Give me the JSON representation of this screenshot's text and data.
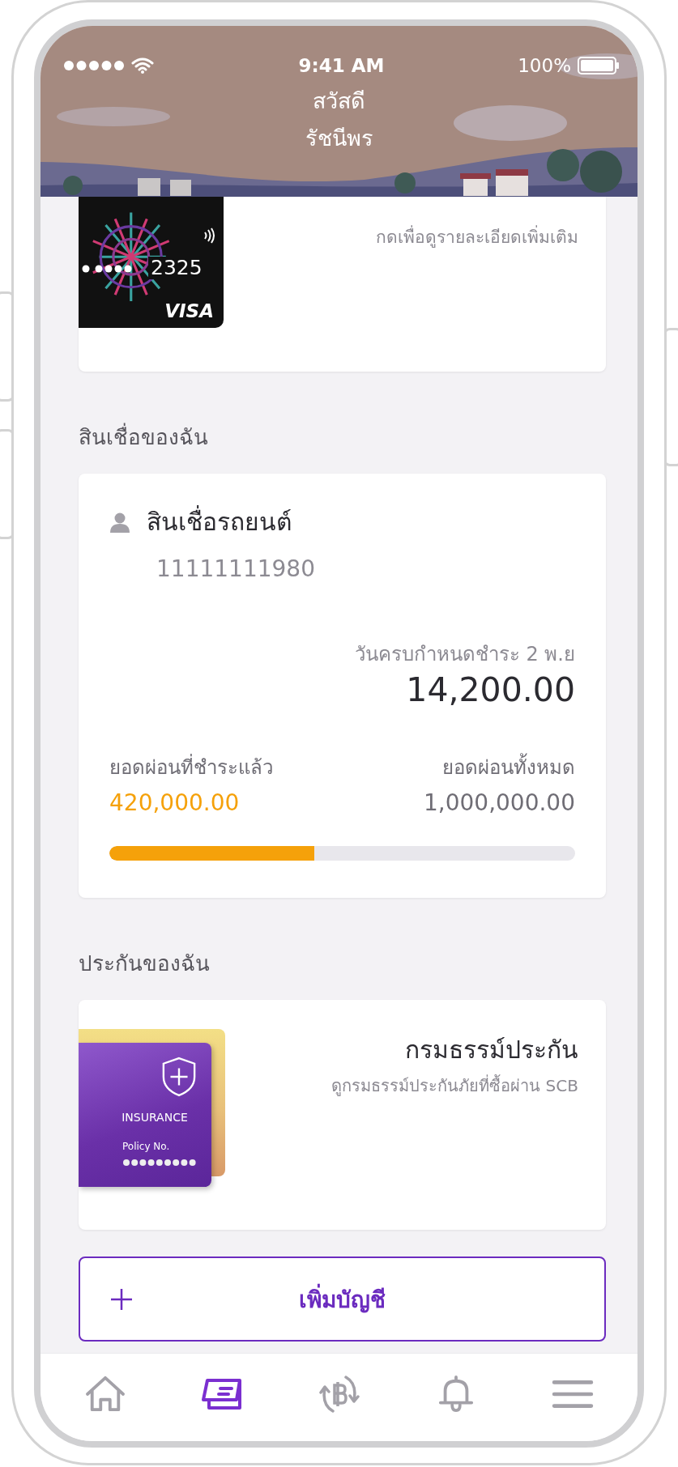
{
  "status_bar": {
    "time": "9:41 AM",
    "battery": "100%"
  },
  "header": {
    "greeting": "สวัสดี",
    "name": "รัชนีพร"
  },
  "card_account": {
    "last_digits": "2325",
    "network": "VISA",
    "hint": "กดเพื่อดูรายละเอียดเพิ่มเติม"
  },
  "loans": {
    "title": "สินเชื่อของฉัน",
    "name": "สินเชื่อรถยนต์",
    "account_number": "11111111980",
    "due_label": "วันครบกำหนดชำระ 2 พ.ย",
    "due_amount": "14,200.00",
    "paid_label": "ยอดผ่อนที่ชำระแล้ว",
    "paid_amount": "420,000.00",
    "total_label": "ยอดผ่อนทั้งหมด",
    "total_amount": "1,000,000.00",
    "level": 0.44
  },
  "insurance": {
    "title": "ประกันของฉัน",
    "card_label": "INSURANCE",
    "card_policy_label": "Policy No.",
    "name": "กรมธรรม์ประกัน",
    "description": "ดูกรมธรรม์ประกันภัยที่ซื้อผ่าน SCB"
  },
  "add_account_button": "เพิ่มบัญชี",
  "tab_bar": [
    {
      "kind": "home",
      "selected": false
    },
    {
      "kind": "cards",
      "selected": true
    },
    {
      "kind": "exchange",
      "selected": false
    },
    {
      "kind": "bell",
      "selected": false
    },
    {
      "kind": "menu",
      "selected": false
    }
  ]
}
